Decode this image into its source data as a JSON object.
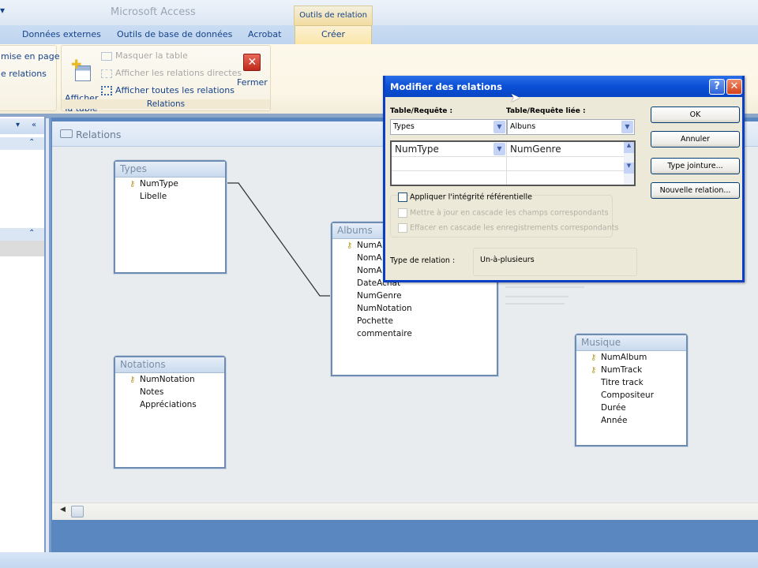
{
  "app": {
    "title": "Microsoft Access",
    "context_tab": "Outils de relation"
  },
  "tabs": [
    {
      "label": "Données externes"
    },
    {
      "label": "Outils de base de données"
    },
    {
      "label": "Acrobat"
    },
    {
      "label": "Créer"
    }
  ],
  "ribbon": {
    "left_group": {
      "items": [
        "mise en page",
        "e relations"
      ]
    },
    "relations_group": {
      "label": "Relations",
      "show_table": "Afficher\nla table",
      "hide_table": "Masquer la table",
      "direct_relations": "Afficher les relations directes",
      "all_relations": "Afficher toutes les relations",
      "close": "Fermer"
    }
  },
  "relations_window": {
    "title": "Relations"
  },
  "tables": [
    {
      "name": "Types",
      "fields": [
        {
          "name": "NumType",
          "key": true
        },
        {
          "name": "Libelle",
          "key": false
        }
      ]
    },
    {
      "name": "Albums",
      "fields": [
        {
          "name": "NumA",
          "key": true
        },
        {
          "name": "NomA",
          "key": false
        },
        {
          "name": "NomA",
          "key": false
        },
        {
          "name": "DateAchat",
          "key": false
        },
        {
          "name": "NumGenre",
          "key": false
        },
        {
          "name": "NumNotation",
          "key": false
        },
        {
          "name": "Pochette",
          "key": false
        },
        {
          "name": "commentaire",
          "key": false
        }
      ]
    },
    {
      "name": "Notations",
      "fields": [
        {
          "name": "NumNotation",
          "key": true
        },
        {
          "name": "Notes",
          "key": false
        },
        {
          "name": "Appréciations",
          "key": false
        }
      ]
    },
    {
      "name": "Musique",
      "fields": [
        {
          "name": "NumAlbum",
          "key": true
        },
        {
          "name": "NumTrack",
          "key": true
        },
        {
          "name": "Titre track",
          "key": false
        },
        {
          "name": "Compositeur",
          "key": false
        },
        {
          "name": "Durée",
          "key": false
        },
        {
          "name": "Année",
          "key": false
        }
      ]
    }
  ],
  "dialog": {
    "title": "Modifier des relations",
    "table_label": "Table/Requête :",
    "related_label": "Table/Requête liée :",
    "table_value": "Types",
    "related_value": "Albuns",
    "field_left": "NumType",
    "field_right": "NumGenre",
    "enforce_integrity": "Appliquer l'intégrité référentielle",
    "cascade_update": "Mettre à jour en cascade les champs correspondants",
    "cascade_delete": "Effacer en cascade les enregistrements correspondants",
    "relation_type_label": "Type de relation :",
    "relation_type_value": "Un-à-plusieurs",
    "ok": "OK",
    "cancel": "Annuler",
    "join_type": "Type jointure...",
    "new_relation": "Nouvelle relation..."
  }
}
